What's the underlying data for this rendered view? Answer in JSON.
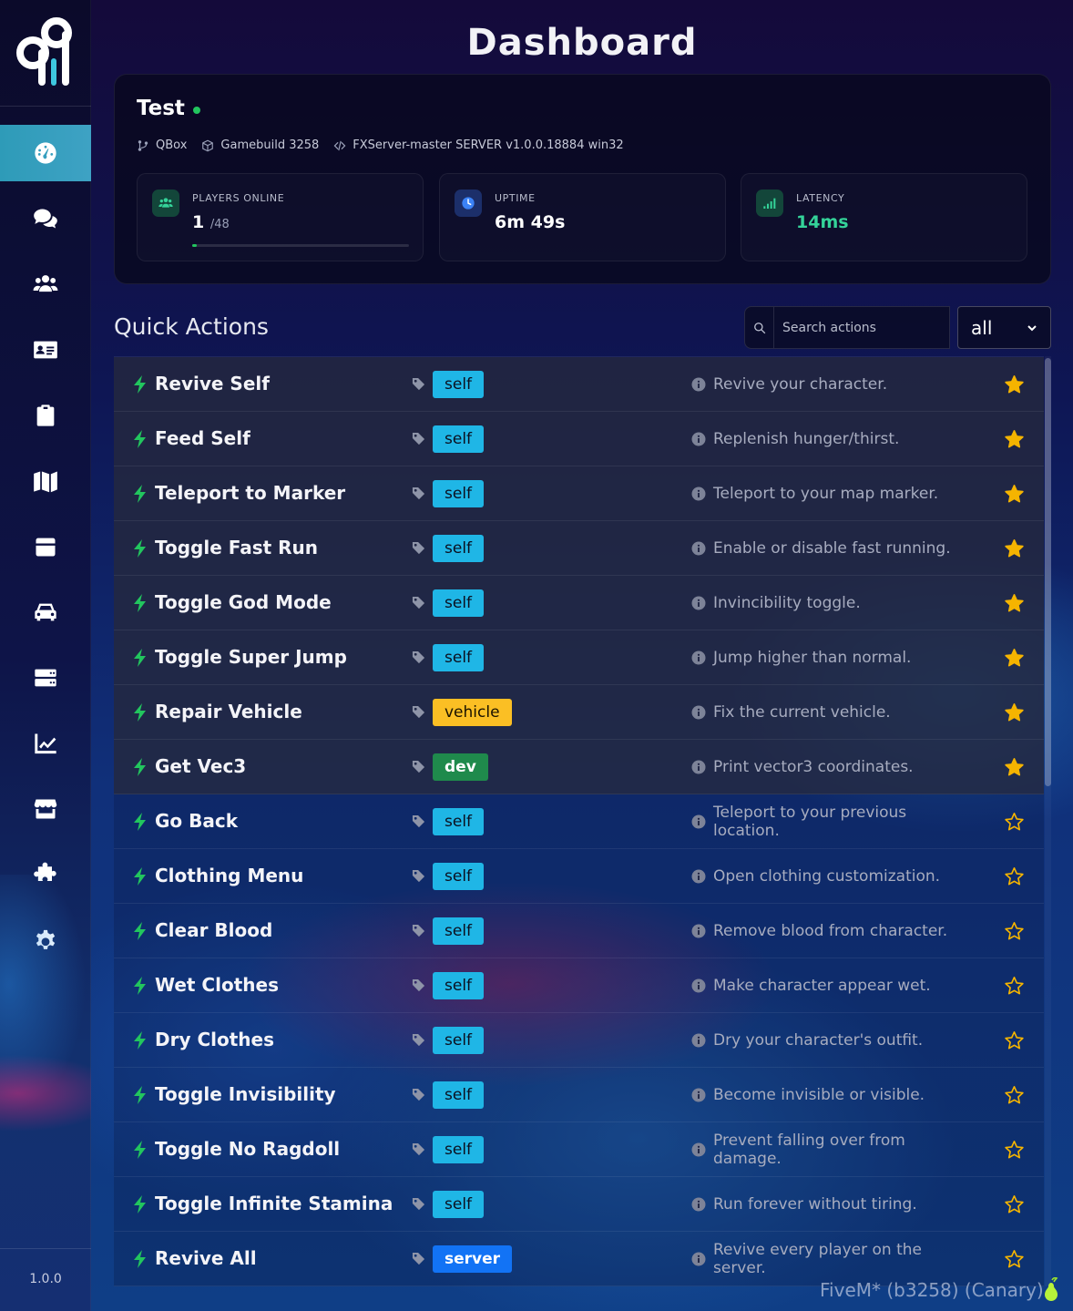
{
  "sidebar": {
    "nav": [
      {
        "icon": "dashboard-gauge-icon",
        "active": true
      },
      {
        "icon": "chat-bubbles-icon",
        "active": false
      },
      {
        "icon": "users-icon",
        "active": false
      },
      {
        "icon": "id-card-icon",
        "active": false
      },
      {
        "icon": "clipboard-icon",
        "active": false
      },
      {
        "icon": "map-icon",
        "active": false
      },
      {
        "icon": "gift-box-icon",
        "active": false
      },
      {
        "icon": "car-icon",
        "active": false
      },
      {
        "icon": "server-icon",
        "active": false
      },
      {
        "icon": "chart-line-icon",
        "active": false
      },
      {
        "icon": "store-icon",
        "active": false
      },
      {
        "icon": "puzzle-icon",
        "active": false
      },
      {
        "icon": "gear-icon",
        "active": false
      }
    ],
    "version": "1.0.0",
    "accent": "#33a0c0"
  },
  "header": {
    "title": "Dashboard"
  },
  "server": {
    "name": "Test",
    "status_color": "#22c55e",
    "framework": "QBox",
    "gamebuild": "Gamebuild 3258",
    "version": "FXServer-master SERVER v1.0.0.18884 win32",
    "stats": {
      "players": {
        "label": "PLAYERS ONLINE",
        "value": "1",
        "max": "/48",
        "fill_fraction": 0.021
      },
      "uptime": {
        "label": "UPTIME",
        "value": "6m 49s"
      },
      "latency": {
        "label": "LATENCY",
        "value": "14ms",
        "color": "#34d399"
      }
    }
  },
  "quick_actions": {
    "title": "Quick Actions",
    "search_placeholder": "Search actions",
    "filter_value": "all",
    "colors": {
      "self": "#1fb6e6",
      "vehicle": "#fbbf24",
      "dev": "#1f8a4c",
      "server": "#1273f5",
      "star": "#f5b400",
      "bolt": "#22c55e"
    },
    "items": [
      {
        "name": "Revive Self",
        "tag": "self",
        "desc": "Revive your character.",
        "favorite": true
      },
      {
        "name": "Feed Self",
        "tag": "self",
        "desc": "Replenish hunger/thirst.",
        "favorite": true
      },
      {
        "name": "Teleport to Marker",
        "tag": "self",
        "desc": "Teleport to your map marker.",
        "favorite": true
      },
      {
        "name": "Toggle Fast Run",
        "tag": "self",
        "desc": "Enable or disable fast running.",
        "favorite": true
      },
      {
        "name": "Toggle God Mode",
        "tag": "self",
        "desc": "Invincibility toggle.",
        "favorite": true
      },
      {
        "name": "Toggle Super Jump",
        "tag": "self",
        "desc": "Jump higher than normal.",
        "favorite": true
      },
      {
        "name": "Repair Vehicle",
        "tag": "vehicle",
        "desc": "Fix the current vehicle.",
        "favorite": true
      },
      {
        "name": "Get Vec3",
        "tag": "dev",
        "desc": "Print vector3 coordinates.",
        "favorite": true
      },
      {
        "name": "Go Back",
        "tag": "self",
        "desc": "Teleport to your previous location.",
        "favorite": false
      },
      {
        "name": "Clothing Menu",
        "tag": "self",
        "desc": "Open clothing customization.",
        "favorite": false
      },
      {
        "name": "Clear Blood",
        "tag": "self",
        "desc": "Remove blood from character.",
        "favorite": false
      },
      {
        "name": "Wet Clothes",
        "tag": "self",
        "desc": "Make character appear wet.",
        "favorite": false
      },
      {
        "name": "Dry Clothes",
        "tag": "self",
        "desc": "Dry your character's outfit.",
        "favorite": false
      },
      {
        "name": "Toggle Invisibility",
        "tag": "self",
        "desc": "Become invisible or visible.",
        "favorite": false
      },
      {
        "name": "Toggle No Ragdoll",
        "tag": "self",
        "desc": "Prevent falling over from damage.",
        "favorite": false
      },
      {
        "name": "Toggle Infinite Stamina",
        "tag": "self",
        "desc": "Run forever without tiring.",
        "favorite": false
      },
      {
        "name": "Revive All",
        "tag": "server",
        "desc": "Revive every player on the server.",
        "favorite": false
      }
    ]
  },
  "footer": {
    "client": "FiveM* (b3258) (Canary)"
  }
}
